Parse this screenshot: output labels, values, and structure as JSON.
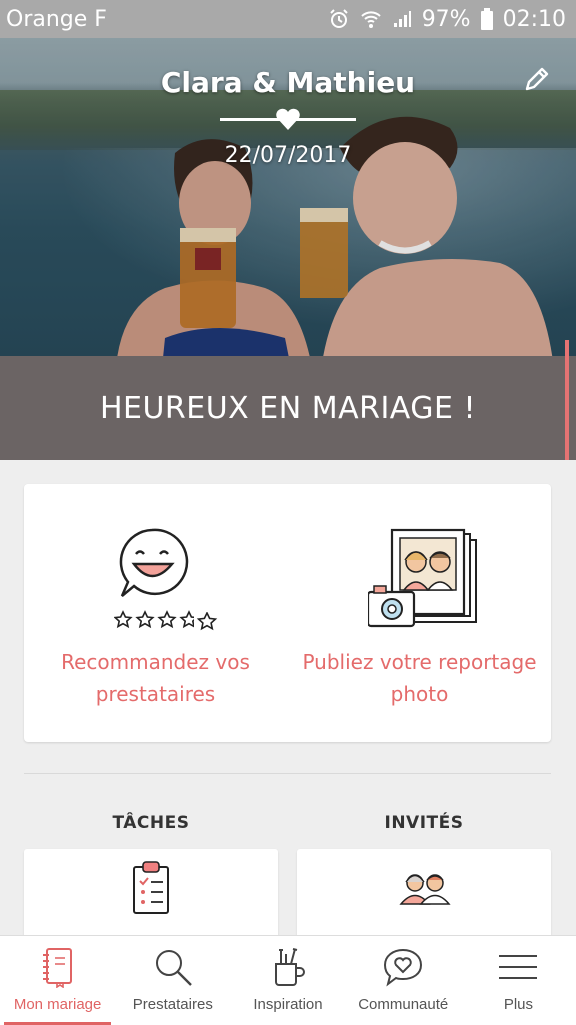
{
  "status_bar": {
    "carrier": "Orange F",
    "battery": "97%",
    "time": "02:10",
    "icons": [
      "alarm-icon",
      "wifi-icon",
      "signal-icon",
      "battery-icon"
    ]
  },
  "header": {
    "couple_name": "Clara & Mathieu",
    "wedding_date": "22/07/2017",
    "edit_icon": "pencil-icon",
    "heart_icon": "heart-icon"
  },
  "banner": {
    "text": "HEUREUX EN MARIAGE !"
  },
  "features": [
    {
      "label": "Recommandez vos prestataires",
      "icon": "review-smiley-icon"
    },
    {
      "label": "Publiez votre reportage photo",
      "icon": "photo-camera-icon"
    }
  ],
  "sections": {
    "tasks_title": "TÂCHES",
    "guests_title": "INVITÉS"
  },
  "bottom_nav": {
    "items": [
      {
        "label": "Mon mariage",
        "icon": "notebook-icon",
        "active": true
      },
      {
        "label": "Prestataires",
        "icon": "search-icon",
        "active": false
      },
      {
        "label": "Inspiration",
        "icon": "inspiration-cup-icon",
        "active": false
      },
      {
        "label": "Communauté",
        "icon": "chat-heart-icon",
        "active": false
      },
      {
        "label": "Plus",
        "icon": "menu-icon",
        "active": false
      }
    ]
  },
  "colors": {
    "accent": "#e06464",
    "banner_bg": "#6b6464",
    "status_bar_bg": "#a9a9a9"
  }
}
